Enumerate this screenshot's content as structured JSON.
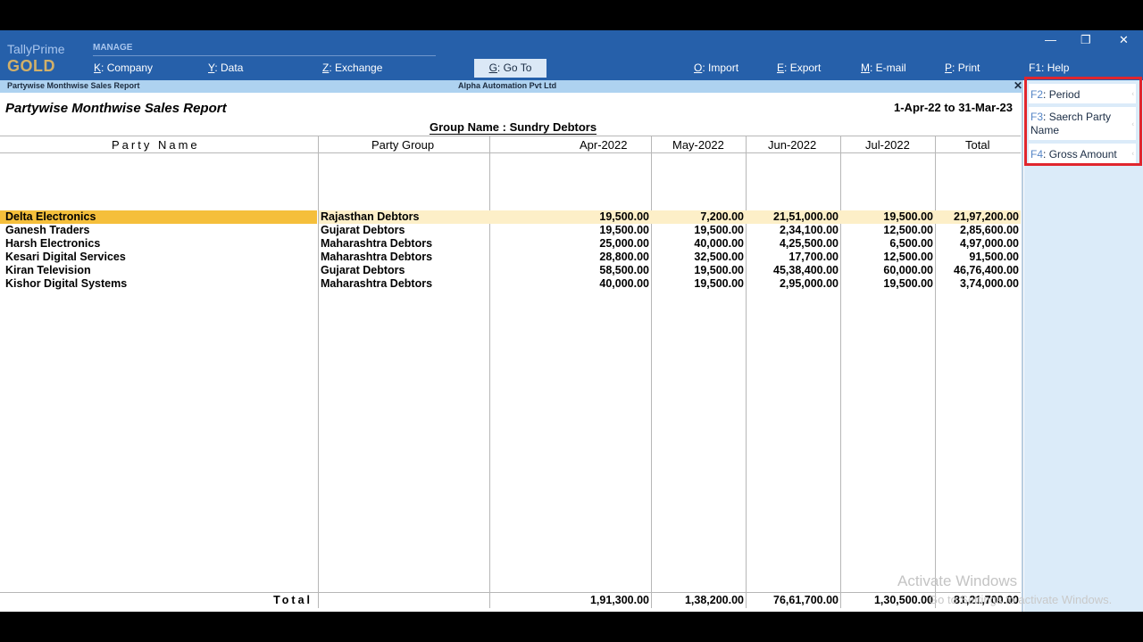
{
  "brand": {
    "name": "TallyPrime",
    "edition": "GOLD"
  },
  "topbar": {
    "manage_label": "MANAGE",
    "menu": [
      {
        "key": "K",
        "label": "Company"
      },
      {
        "key": "Y",
        "label": "Data"
      },
      {
        "key": "Z",
        "label": "Exchange"
      },
      {
        "key": "G",
        "label": "Go To"
      },
      {
        "key": "O",
        "label": "Import"
      },
      {
        "key": "E",
        "label": "Export"
      },
      {
        "key": "M",
        "label": "E-mail"
      },
      {
        "key": "P",
        "label": "Print"
      },
      {
        "key": "F1",
        "label": "Help"
      }
    ]
  },
  "titlestrip": {
    "report_name": "Partywise Monthwise Sales Report",
    "company": "Alpha Automation Pvt Ltd"
  },
  "report": {
    "title": "Partywise Monthwise Sales Report",
    "period": "1-Apr-22 to 31-Mar-23",
    "group": "Group Name : Sundry Debtors",
    "columns": [
      "Party Name",
      "Party Group",
      "Apr-2022",
      "May-2022",
      "Jun-2022",
      "Jul-2022",
      "Total"
    ],
    "rows": [
      {
        "name": "Delta Electronics",
        "group": "Rajasthan Debtors",
        "apr": "19,500.00",
        "may": "7,200.00",
        "jun": "21,51,000.00",
        "jul": "19,500.00",
        "total": "21,97,200.00"
      },
      {
        "name": "Ganesh Traders",
        "group": "Gujarat Debtors",
        "apr": "19,500.00",
        "may": "19,500.00",
        "jun": "2,34,100.00",
        "jul": "12,500.00",
        "total": "2,85,600.00"
      },
      {
        "name": "Harsh Electronics",
        "group": "Maharashtra Debtors",
        "apr": "25,000.00",
        "may": "40,000.00",
        "jun": "4,25,500.00",
        "jul": "6,500.00",
        "total": "4,97,000.00"
      },
      {
        "name": "Kesari Digital Services",
        "group": "Maharashtra Debtors",
        "apr": "28,800.00",
        "may": "32,500.00",
        "jun": "17,700.00",
        "jul": "12,500.00",
        "total": "91,500.00"
      },
      {
        "name": "Kiran Television",
        "group": "Gujarat Debtors",
        "apr": "58,500.00",
        "may": "19,500.00",
        "jun": "45,38,400.00",
        "jul": "60,000.00",
        "total": "46,76,400.00"
      },
      {
        "name": "Kishor Digital Systems",
        "group": "Maharashtra Debtors",
        "apr": "40,000.00",
        "may": "19,500.00",
        "jun": "2,95,000.00",
        "jul": "19,500.00",
        "total": "3,74,000.00"
      }
    ],
    "totals": {
      "label": "Total",
      "apr": "1,91,300.00",
      "may": "1,38,200.00",
      "jun": "76,61,700.00",
      "jul": "1,30,500.00",
      "total": "81,21,700.00"
    }
  },
  "side": [
    {
      "key": "F2",
      "label": "Period"
    },
    {
      "key": "F3",
      "label": "Saerch Party Name"
    },
    {
      "key": "F4",
      "label": "Gross Amount"
    }
  ],
  "watermark": {
    "line1": "Activate Windows",
    "line2": "Go to Settings to activate Windows."
  }
}
